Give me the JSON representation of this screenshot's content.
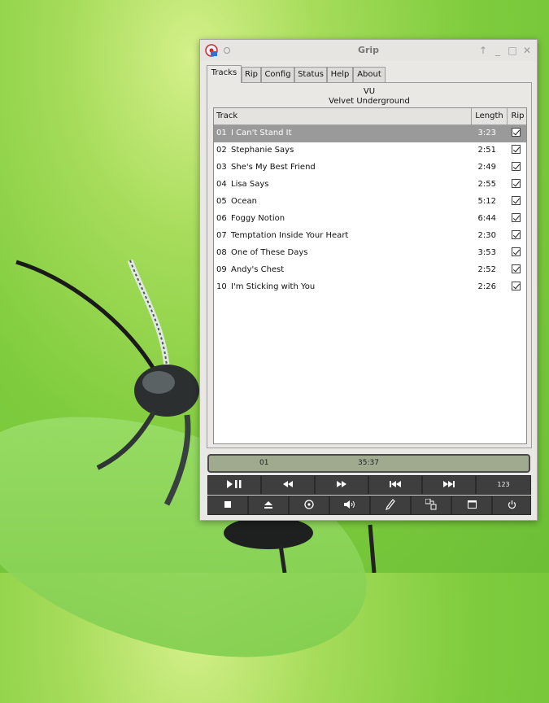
{
  "window": {
    "title": "Grip"
  },
  "tabs": [
    {
      "label": "Tracks",
      "active": true
    },
    {
      "label": "Rip"
    },
    {
      "label": "Config"
    },
    {
      "label": "Status"
    },
    {
      "label": "Help"
    },
    {
      "label": "About"
    }
  ],
  "disc": {
    "artist_short": "VU",
    "artist": "Velvet Underground"
  },
  "table": {
    "headers": {
      "track": "Track",
      "length": "Length",
      "rip": "Rip"
    },
    "rows": [
      {
        "num": "01",
        "name": "I Can't Stand It",
        "length": "3:23",
        "rip": true,
        "selected": true
      },
      {
        "num": "02",
        "name": "Stephanie Says",
        "length": "2:51",
        "rip": true
      },
      {
        "num": "03",
        "name": "She's My Best Friend",
        "length": "2:49",
        "rip": true
      },
      {
        "num": "04",
        "name": "Lisa Says",
        "length": "2:55",
        "rip": true
      },
      {
        "num": "05",
        "name": "Ocean",
        "length": "5:12",
        "rip": true
      },
      {
        "num": "06",
        "name": "Foggy Notion",
        "length": "6:44",
        "rip": true
      },
      {
        "num": "07",
        "name": "Temptation Inside Your Heart",
        "length": "2:30",
        "rip": true
      },
      {
        "num": "08",
        "name": "One of These Days",
        "length": "3:53",
        "rip": true
      },
      {
        "num": "09",
        "name": "Andy's Chest",
        "length": "2:52",
        "rip": true
      },
      {
        "num": "10",
        "name": "I'm Sticking with You",
        "length": "2:26",
        "rip": true
      }
    ]
  },
  "status": {
    "track": "01",
    "time": "35:37"
  },
  "controls": {
    "row1": [
      "play-pause-icon",
      "rewind-icon",
      "fast-forward-icon",
      "previous-track-icon",
      "next-track-icon",
      "track-numbers-icon"
    ],
    "row1_label_123": "123",
    "row2": [
      "stop-icon",
      "eject-icon",
      "record-icon",
      "volume-icon",
      "edit-icon",
      "discdb-icon",
      "window-icon",
      "power-icon"
    ]
  },
  "colors": {
    "status_bg": "#9faa8e",
    "selection": "#9a9a9a",
    "button_bg": "#3e3e3e"
  }
}
